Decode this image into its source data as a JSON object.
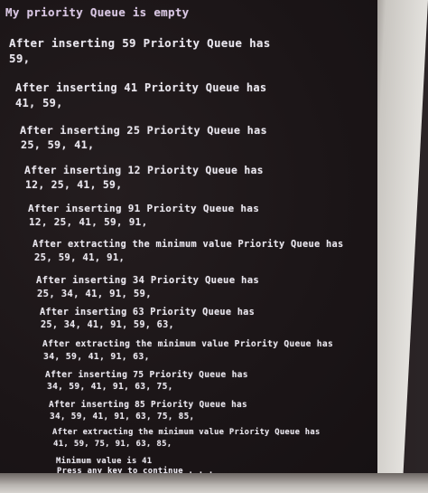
{
  "console": {
    "lines": [
      "My priority Queue is empty",
      "After inserting 59 Priority Queue has",
      "59,",
      "After inserting 41 Priority Queue has",
      "41, 59,",
      "After inserting 25 Priority Queue has",
      "25, 59, 41,",
      "After inserting 12 Priority Queue has",
      "12, 25, 41, 59,",
      "After inserting 91 Priority Queue has",
      "12, 25, 41, 59, 91,",
      "After extracting the minimum value Priority Queue has",
      "25, 59, 41, 91,",
      "After inserting 34 Priority Queue has",
      "25, 34, 41, 91, 59,",
      "After inserting 63 Priority Queue has",
      "25, 34, 41, 91, 59, 63,",
      "After extracting the minimum value Priority Queue has",
      "34, 59, 41, 91, 63,",
      "After inserting 75 Priority Queue has",
      "34, 59, 41, 91, 63, 75,",
      "After inserting 85 Priority Queue has",
      "34, 59, 41, 91, 63, 75, 85,",
      "After extracting the minimum value Priority Queue has",
      "41, 59, 75, 91, 63, 85,",
      "Minimum value is 41",
      "Press any key to continue . . ."
    ]
  },
  "colors": {
    "console_background": "#1b1517",
    "console_text": "#e9e6ee"
  }
}
